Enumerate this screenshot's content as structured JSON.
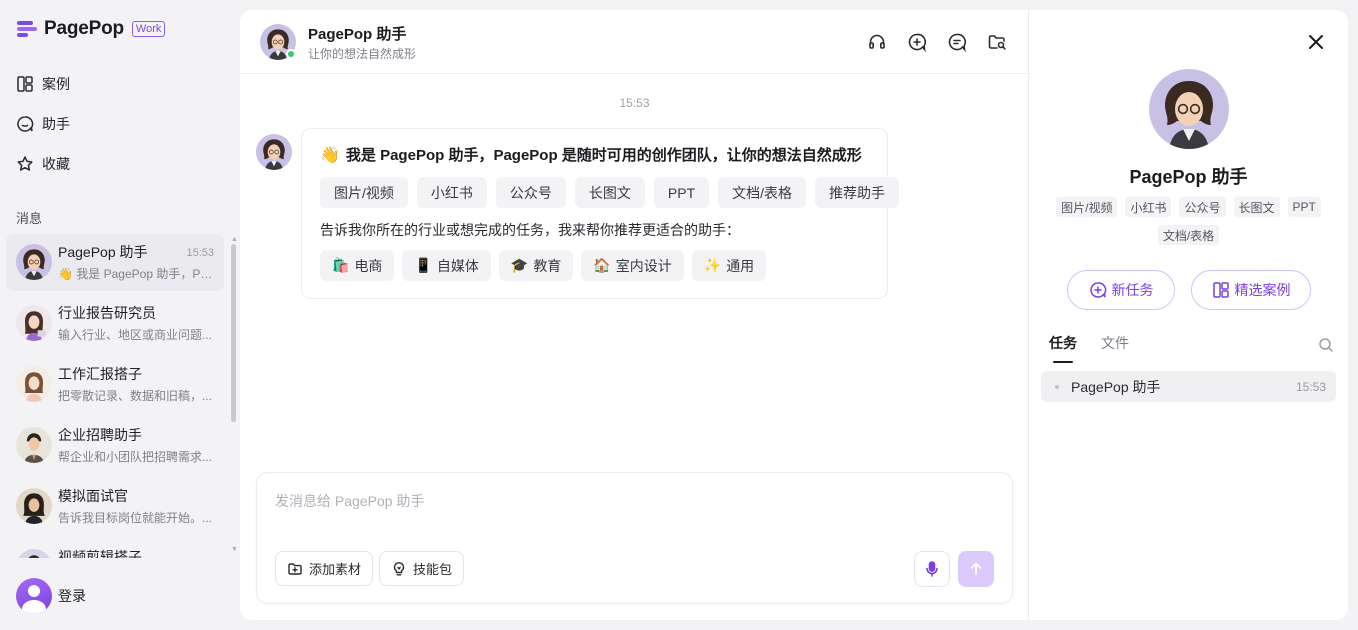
{
  "brand": {
    "name": "PagePop",
    "badge": "Work",
    "accent": "#8a5cf0"
  },
  "nav": [
    {
      "label": "案例",
      "icon": "layout-icon"
    },
    {
      "label": "助手",
      "icon": "assistant-icon"
    },
    {
      "label": "收藏",
      "icon": "star-icon"
    }
  ],
  "messages": {
    "title": "消息",
    "conversations": [
      {
        "name": "PagePop 助手",
        "time": "15:53",
        "preview": "👋 我是 PagePop 助手，PagePop 是随时可用的创作团队"
      },
      {
        "name": "行业报告研究员",
        "time": "",
        "preview": "输入行业、地区或商业问题..."
      },
      {
        "name": "工作汇报搭子",
        "time": "",
        "preview": "把零散记录、数据和旧稿，..."
      },
      {
        "name": "企业招聘助手",
        "time": "",
        "preview": "帮企业和小团队把招聘需求..."
      },
      {
        "name": "模拟面试官",
        "time": "",
        "preview": "告诉我目标岗位就能开始。..."
      },
      {
        "name": "视频剪辑搭子",
        "time": "",
        "preview": ""
      }
    ]
  },
  "login": {
    "label": "登录"
  },
  "chat": {
    "name": "PagePop 助手",
    "subtitle": "让你的想法自然成形",
    "timestamp": "15:53",
    "greeting_emoji": "👋",
    "greeting": "我是 PagePop 助手，PagePop 是随时可用的创作团队，让你的想法自然成形",
    "chips": [
      "图片/视频",
      "小红书",
      "公众号",
      "长图文",
      "PPT",
      "文档/表格",
      "推荐助手"
    ],
    "hint": "告诉我你所在的行业或想完成的任务，我来帮你推荐更适合的助手：",
    "industries": [
      {
        "emoji": "🛍️",
        "label": "电商"
      },
      {
        "emoji": "📱",
        "label": "自媒体"
      },
      {
        "emoji": "🎓",
        "label": "教育"
      },
      {
        "emoji": "🏠",
        "label": "室内设计"
      },
      {
        "emoji": "✨",
        "label": "通用"
      }
    ]
  },
  "composer": {
    "placeholder": "发消息给 PagePop 助手",
    "add_material": "添加素材",
    "skill_pack": "技能包"
  },
  "panel": {
    "name": "PagePop 助手",
    "tags": [
      "图片/视频",
      "小红书",
      "公众号",
      "长图文",
      "PPT",
      "文档/表格"
    ],
    "new_task": "新任务",
    "featured_cases": "精选案例",
    "tabs": [
      "任务",
      "文件"
    ],
    "tasks": [
      {
        "name": "PagePop 助手",
        "time": "15:53"
      }
    ]
  },
  "colors": {
    "accent": "#7a3ee6",
    "send_disabled": "#dccafc",
    "online": "#2ecc71"
  }
}
